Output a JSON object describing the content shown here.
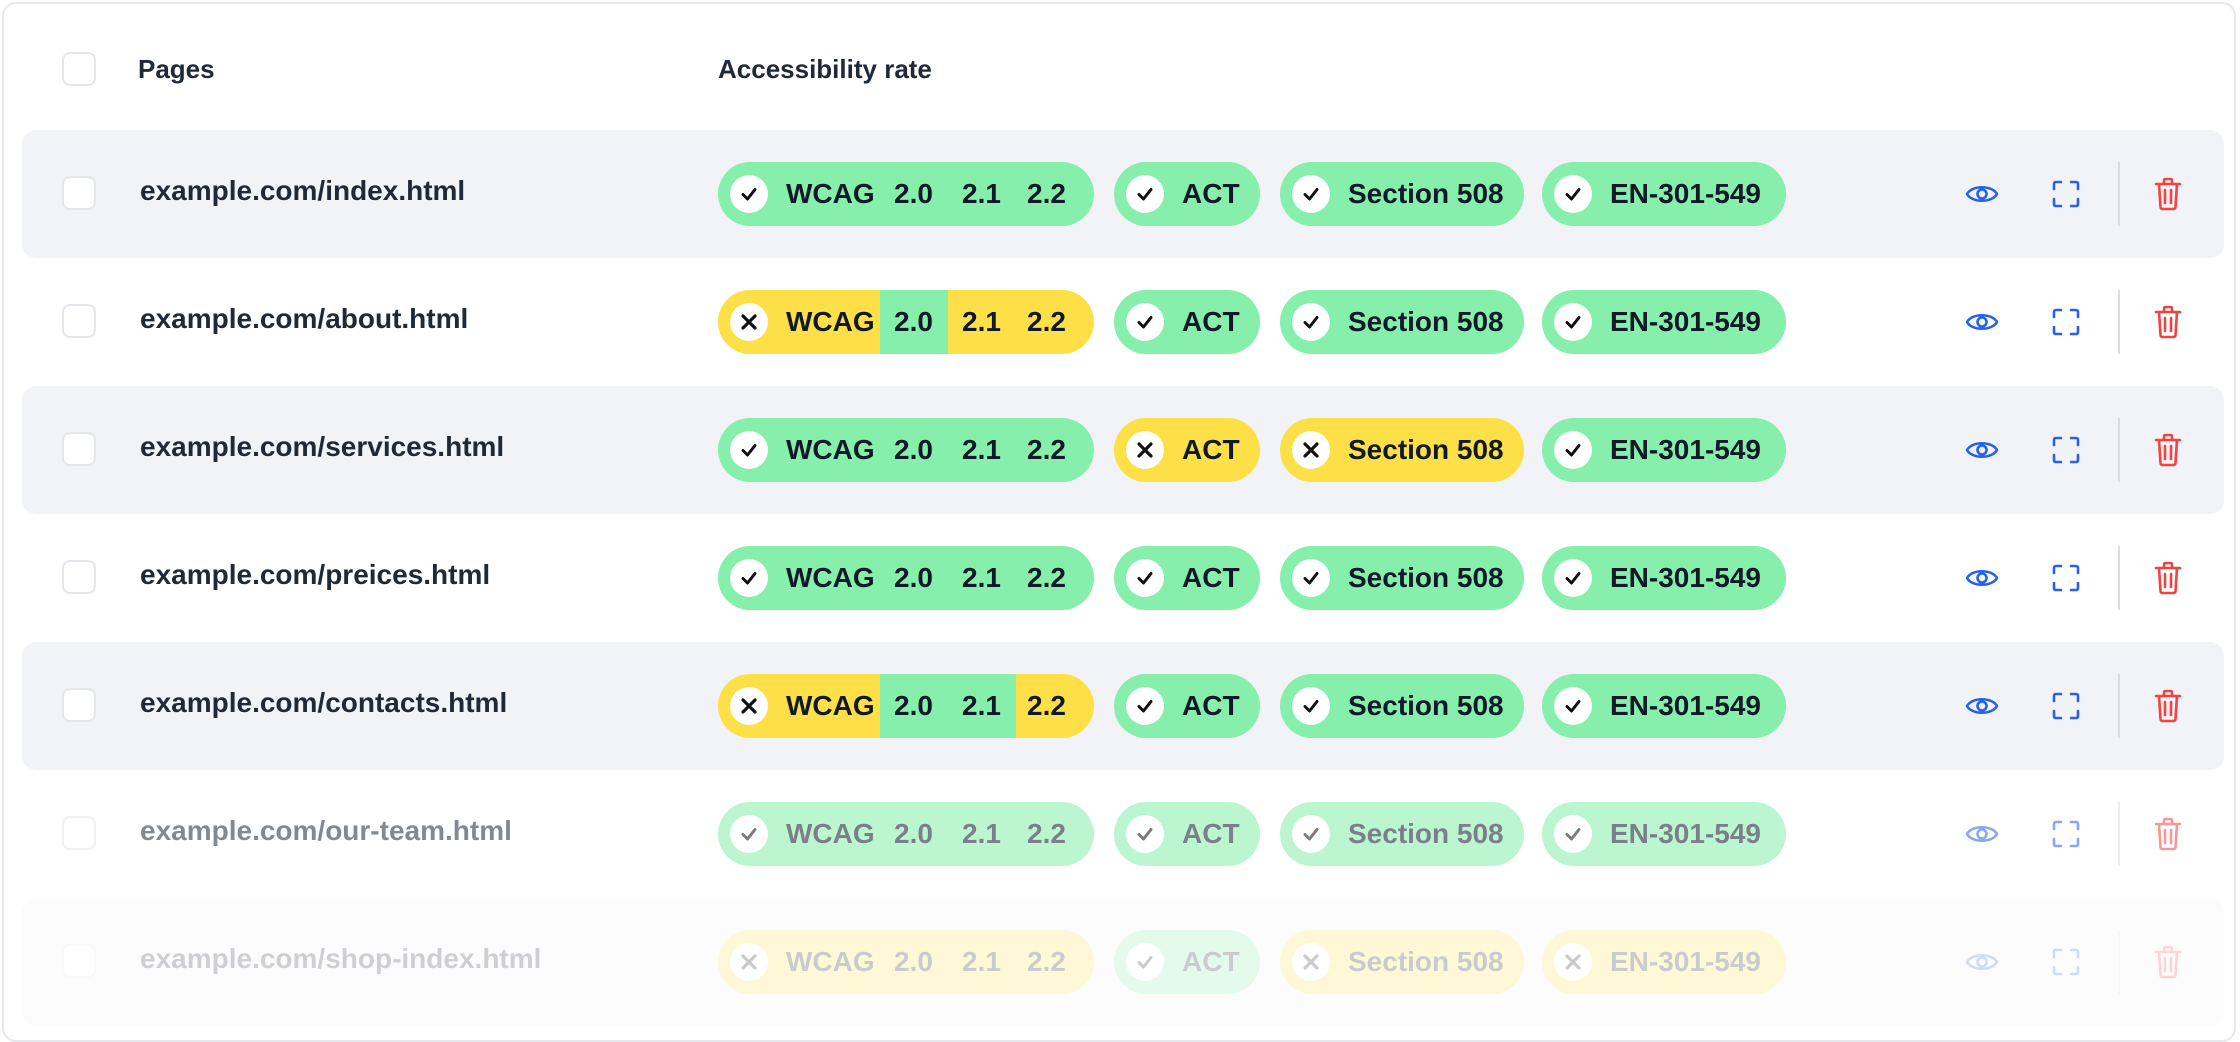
{
  "header": {
    "pages_label": "Pages",
    "rate_label": "Accessibility rate"
  },
  "colors": {
    "pass": "#86efac",
    "fail": "#fde047",
    "eye": "#2563eb",
    "trash": "#ef4444"
  },
  "rows": [
    {
      "url": "example.com/index.html",
      "wcag": {
        "label": "WCAG",
        "status": "pass",
        "v20": "2.0",
        "v21": "2.1",
        "v22": "2.2",
        "seg20": "pass",
        "seg21": "pass",
        "seg22": "pass"
      },
      "act": {
        "label": "ACT",
        "status": "pass"
      },
      "s508": {
        "label": "Section 508",
        "status": "pass"
      },
      "en": {
        "label": "EN-301-549",
        "status": "pass"
      }
    },
    {
      "url": "example.com/about.html",
      "wcag": {
        "label": "WCAG",
        "status": "fail",
        "v20": "2.0",
        "v21": "2.1",
        "v22": "2.2",
        "seg20": "pass",
        "seg21": "fail",
        "seg22": "fail"
      },
      "act": {
        "label": "ACT",
        "status": "pass"
      },
      "s508": {
        "label": "Section 508",
        "status": "pass"
      },
      "en": {
        "label": "EN-301-549",
        "status": "pass"
      }
    },
    {
      "url": "example.com/services.html",
      "wcag": {
        "label": "WCAG",
        "status": "pass",
        "v20": "2.0",
        "v21": "2.1",
        "v22": "2.2",
        "seg20": "pass",
        "seg21": "pass",
        "seg22": "pass"
      },
      "act": {
        "label": "ACT",
        "status": "fail"
      },
      "s508": {
        "label": "Section 508",
        "status": "fail"
      },
      "en": {
        "label": "EN-301-549",
        "status": "pass"
      }
    },
    {
      "url": "example.com/preices.html",
      "wcag": {
        "label": "WCAG",
        "status": "pass",
        "v20": "2.0",
        "v21": "2.1",
        "v22": "2.2",
        "seg20": "pass",
        "seg21": "pass",
        "seg22": "pass"
      },
      "act": {
        "label": "ACT",
        "status": "pass"
      },
      "s508": {
        "label": "Section 508",
        "status": "pass"
      },
      "en": {
        "label": "EN-301-549",
        "status": "pass"
      }
    },
    {
      "url": "example.com/contacts.html",
      "wcag": {
        "label": "WCAG",
        "status": "fail",
        "v20": "2.0",
        "v21": "2.1",
        "v22": "2.2",
        "seg20": "pass",
        "seg21": "pass",
        "seg22": "fail"
      },
      "act": {
        "label": "ACT",
        "status": "pass"
      },
      "s508": {
        "label": "Section 508",
        "status": "pass"
      },
      "en": {
        "label": "EN-301-549",
        "status": "pass"
      }
    },
    {
      "url": "example.com/our-team.html",
      "wcag": {
        "label": "WCAG",
        "status": "pass",
        "v20": "2.0",
        "v21": "2.1",
        "v22": "2.2",
        "seg20": "pass",
        "seg21": "pass",
        "seg22": "pass"
      },
      "act": {
        "label": "ACT",
        "status": "pass"
      },
      "s508": {
        "label": "Section 508",
        "status": "pass"
      },
      "en": {
        "label": "EN-301-549",
        "status": "pass"
      }
    },
    {
      "url": "example.com/shop-index.html",
      "wcag": {
        "label": "WCAG",
        "status": "fail",
        "v20": "2.0",
        "v21": "2.1",
        "v22": "2.2",
        "seg20": "fail",
        "seg21": "fail",
        "seg22": "fail"
      },
      "act": {
        "label": "ACT",
        "status": "pass"
      },
      "s508": {
        "label": "Section 508",
        "status": "fail"
      },
      "en": {
        "label": "EN-301-549",
        "status": "fail"
      }
    }
  ]
}
